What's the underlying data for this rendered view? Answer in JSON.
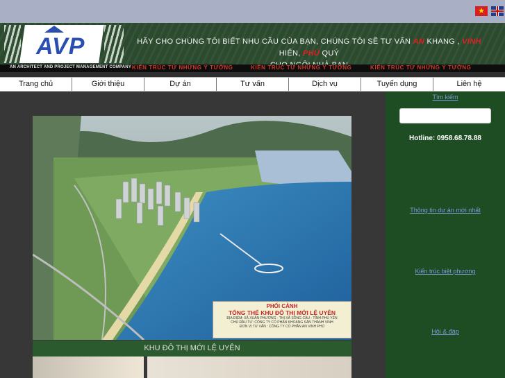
{
  "languages": [
    {
      "name": "Tiếng Việt",
      "icon": "vietnam-flag-icon"
    },
    {
      "name": "English",
      "icon": "uk-flag-icon"
    }
  ],
  "header": {
    "logo_text": "AVP",
    "company_name": "AN ARCHITECT AND PROJECT MANAGEMENT COMPANY",
    "slogan_line1_a": "HÃY CHO CHÚNG TÔI BIẾT NHU CẦU CỦA BẠN, CHÚNG TÔI SẼ TƯ VẤN ",
    "slogan_an": "AN",
    "slogan_line1_b": " KHANG , ",
    "slogan_vinh": "VINH",
    "slogan_line1_c": " HIỂN, ",
    "slogan_phu": "PHÚ",
    "slogan_line1_d": " QUÝ",
    "slogan_line2": "CHO NGÔI NHÀ BẠN",
    "motto": "KIẾN TRÚC TỪ NHỮNG Ý TƯỞNG"
  },
  "nav": {
    "items": [
      "Trang chủ",
      "Giới thiệu",
      "Dự án",
      "Tư vấn",
      "Dịch vụ",
      "Tuyển dụng",
      "Liên hệ"
    ]
  },
  "main": {
    "caption_line1": "PHỐI CẢNH",
    "caption_line2": "TỔNG THỂ KHU ĐÔ THỊ MỚI LỆ UYÊN",
    "caption_line3": "ĐỊA ĐIỂM: XÃ XUÂN PHƯƠNG - THỊ XÃ SÔNG CẦU - TỈNH PHÚ YÊN",
    "caption_line4": "CHỦ ĐẦU TƯ: CÔNG TY CỔ PHẦN KHOÁNG SẢN THÀNH VINH",
    "caption_line5": "ĐƠN VỊ TƯ VẤN : CÔNG TY CỔ PHẦN AN VINH PHÚ",
    "project_title": "KHU ĐÔ THỊ MỚI LỆ UYÊN"
  },
  "sidebar": {
    "top_link": "Tìm kiếm",
    "search_placeholder": "",
    "hotline": "Hotline: 0958.68.78.88",
    "link1": "Thông tin dự án mới nhất",
    "link2": "Kiến trúc biệt phương",
    "link3": "Hỏi & đáp"
  },
  "colors": {
    "topbar": "#a9b0c6",
    "header": "#2b4a2e",
    "sidebar": "#1e4d24",
    "accent_red": "#e02020"
  }
}
